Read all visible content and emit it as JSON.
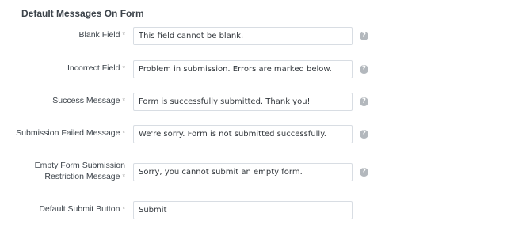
{
  "section": {
    "title": "Default Messages On Form"
  },
  "fields": [
    {
      "label": "Blank Field",
      "required_mark": "*",
      "value": "This field cannot be blank.",
      "help_icon": "question-circle-icon"
    },
    {
      "label": "Incorrect Field",
      "required_mark": "*",
      "value": "Problem in submission. Errors are marked below.",
      "help_icon": "question-circle-icon"
    },
    {
      "label": "Success Message",
      "required_mark": "*",
      "value": "Form is successfully submitted. Thank you!",
      "help_icon": "question-circle-icon"
    },
    {
      "label": "Submission Failed Message",
      "required_mark": "*",
      "value": "We're sorry. Form is not submitted successfully.",
      "help_icon": "question-circle-icon"
    },
    {
      "label_line1": "Empty Form Submission",
      "label_line2": "Restriction Message",
      "required_mark": "*",
      "value": "Sorry, you cannot submit an empty form.",
      "help_icon": "question-circle-icon"
    },
    {
      "label": "Default Submit Button",
      "required_mark": "*",
      "value": "Submit"
    }
  ],
  "help_glyph": "?"
}
